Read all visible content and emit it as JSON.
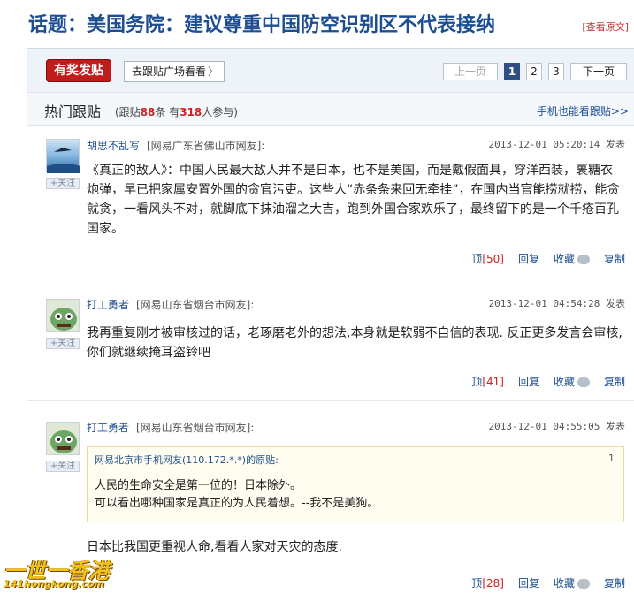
{
  "topic": {
    "title": "话题：美国务院：建议尊重中国防空识别区不代表接纳",
    "view_original": "[查看原文]"
  },
  "toolbar": {
    "hot_button": "有奖发贴",
    "go_square": "去跟贴广场看看",
    "go_square_arrow": "〉",
    "pager": {
      "prev": "上一页",
      "pages": [
        "1",
        "2",
        "3"
      ],
      "active": "1",
      "next": "下一页"
    }
  },
  "section": {
    "title": "热门跟贴",
    "stats_prefix": "(跟贴",
    "follow_count": "88",
    "stats_mid": "条 有",
    "participants": "318",
    "stats_suffix": "人参与)",
    "mobile_link": "手机也能看跟贴>>"
  },
  "posts": [
    {
      "user": "胡思不乱写",
      "location": "[网易广东省佛山市网友]:",
      "time": "2013-12-01 05:20:14 发表",
      "body": "《真正的敌人》：中国人民最大敌人并不是日本，也不是美国，而是戴假面具，穿洋西装，裹糖衣炮弹，早已把家属安置外国的贪官污吏。这些人“赤条条来回无牵挂”，在国内当官能捞就捞，能贪就贪，一看风头不对，就脚底下抹油溜之大吉，跑到外国合家欢乐了，最终留下的是一个千疮百孔国家。",
      "up_label": "顶",
      "up_count": "[50]",
      "reply": "回复",
      "fav": "收藏",
      "copy": "复制",
      "follow": "+关注"
    },
    {
      "user": "打工勇者",
      "location": "[网易山东省烟台市网友]:",
      "time": "2013-12-01 04:54:28 发表",
      "body": "我再重复刚才被审核过的话，老琢磨老外的想法,本身就是软弱不自信的表现. 反正更多发言会审核,你们就继续掩耳盗铃吧",
      "up_label": "顶",
      "up_count": "[41]",
      "reply": "回复",
      "fav": "收藏",
      "copy": "复制",
      "follow": "+关注"
    },
    {
      "user": "打工勇者",
      "location": "[网易山东省烟台市网友]:",
      "time": "2013-12-01 04:55:05 发表",
      "quote": {
        "head": "网易北京市手机网友(110.172.*.*)的原贴:",
        "num": "1",
        "line1": "人民的生命安全是第一位的！日本除外。",
        "line2": "可以看出哪种国家是真正的为人民着想。--我不是美狗。"
      },
      "body": "日本比我国更重视人命,看看人家对天灾的态度.",
      "up_label": "顶",
      "up_count": "[28]",
      "reply": "回复",
      "fav": "收藏",
      "copy": "复制",
      "follow": "+关注"
    }
  ],
  "watermark": {
    "cn": "一世一香港",
    "en": "141hongkong.com"
  }
}
